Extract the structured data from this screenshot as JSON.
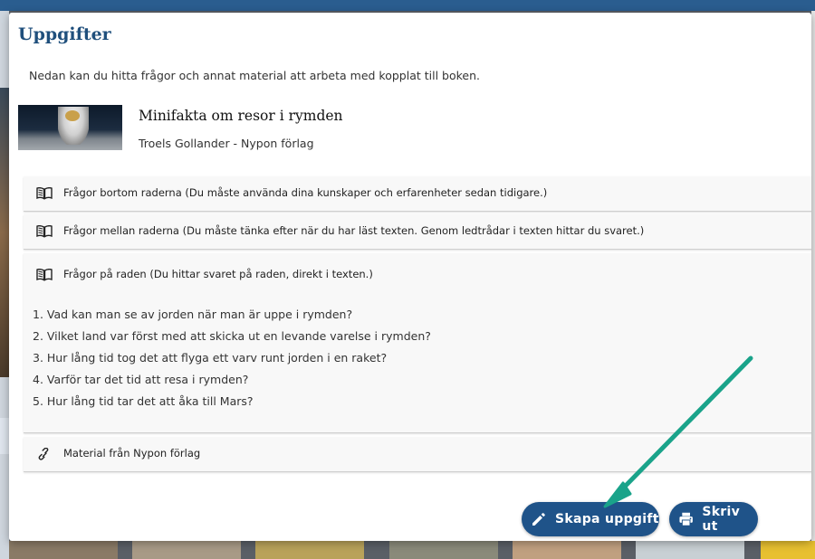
{
  "modal": {
    "title": "Uppgifter",
    "intro": "Nedan kan du hitta frågor och annat material att arbeta med kopplat till boken."
  },
  "book": {
    "title": "Minifakta om resor i rymden",
    "author": "Troels Gollander - Nypon förlag"
  },
  "sections": [
    {
      "label": "Frågor bortom raderna (Du måste använda dina kunskaper och erfarenheter sedan tidigare.)",
      "icon": "book-icon",
      "expanded": false
    },
    {
      "label": "Frågor mellan raderna (Du måste tänka efter när du har läst texten. Genom ledtrådar i texten hittar du svaret.)",
      "icon": "book-icon",
      "expanded": false
    },
    {
      "label": "Frågor på raden (Du hittar svaret på raden, direkt i texten.)",
      "icon": "book-icon",
      "expanded": true,
      "questions": [
        "1. Vad kan man se av jorden när man är uppe i rymden?",
        "2. Vilket land var först med att skicka ut en levande varelse i rymden?",
        "3. Hur lång tid tog det att flyga ett varv runt jorden i en raket?",
        "4. Varför tar det tid att resa i rymden?",
        "5. Hur lång tid tar det att åka till Mars?"
      ]
    },
    {
      "label": "Material från Nypon förlag",
      "icon": "link-icon",
      "expanded": false
    }
  ],
  "buttons": {
    "create": "Skapa uppgift",
    "print": "Skriv ut"
  },
  "colors": {
    "accent": "#1f5389",
    "title": "#1f4f7c",
    "arrow": "#1aa38a"
  }
}
